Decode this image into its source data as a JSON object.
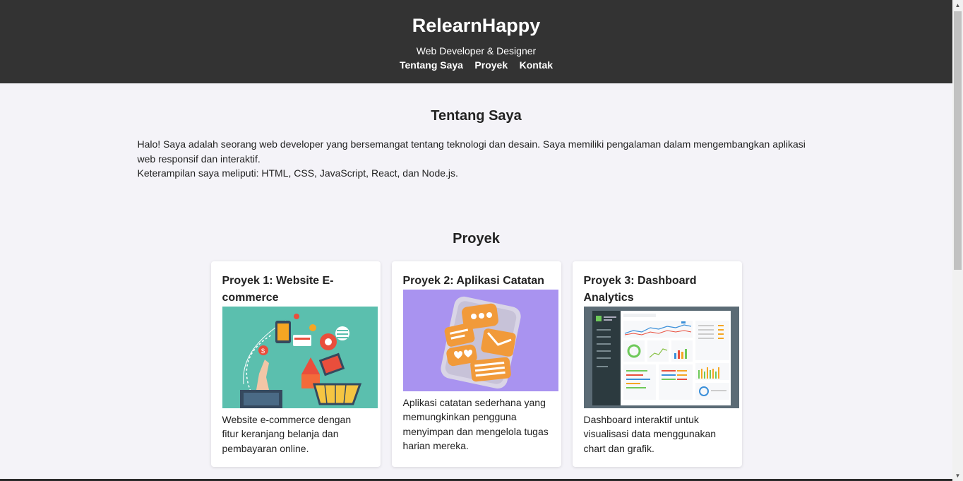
{
  "header": {
    "title": "RelearnHappy",
    "subtitle": "Web Developer & Designer",
    "nav": [
      {
        "label": "Tentang Saya"
      },
      {
        "label": "Proyek"
      },
      {
        "label": "Kontak"
      }
    ]
  },
  "about": {
    "title": "Tentang Saya",
    "paragraph1": "Halo! Saya adalah seorang web developer yang bersemangat tentang teknologi dan desain. Saya memiliki pengalaman dalam mengembangkan aplikasi web responsif dan interaktif.",
    "paragraph2": "Keterampilan saya meliputi: HTML, CSS, JavaScript, React, dan Node.js."
  },
  "projects": {
    "title": "Proyek",
    "items": [
      {
        "title": "Proyek 1: Website E-commerce",
        "description": "Website e-commerce dengan fitur keranjang belanja dan pembayaran online.",
        "image": "ecommerce-illustration"
      },
      {
        "title": "Proyek 2: Aplikasi Catatan",
        "description": "Aplikasi catatan sederhana yang memungkinkan pengguna menyimpan dan mengelola tugas harian mereka.",
        "image": "notes-app-illustration"
      },
      {
        "title": "Proyek 3: Dashboard Analytics",
        "description": "Dashboard interaktif untuk visualisasi data menggunakan chart dan grafik.",
        "image": "dashboard-screenshot"
      }
    ]
  },
  "colors": {
    "header_bg": "#333333",
    "page_bg": "#f4f3f8",
    "card_bg": "#ffffff",
    "ecommerce_bg": "#5bbfae",
    "notes_bg": "#a993f0",
    "notes_accent": "#f19a3a",
    "dashboard_bg": "#5b6b75"
  }
}
